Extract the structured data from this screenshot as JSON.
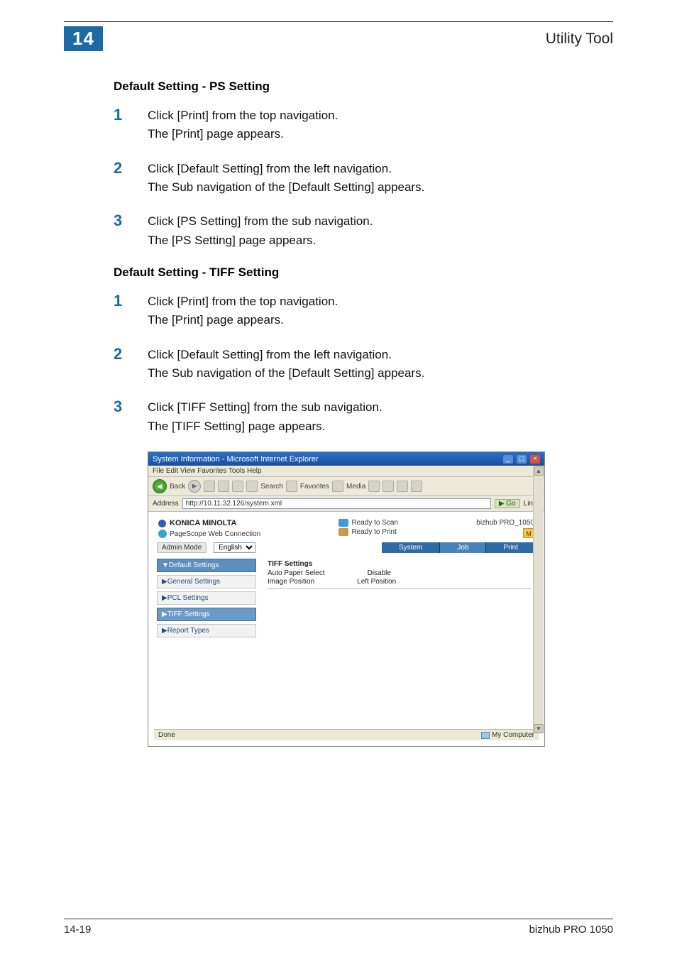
{
  "header": {
    "chapter_number": "14",
    "chapter_title": "Utility Tool"
  },
  "sections": [
    {
      "heading": "Default Setting - PS Setting",
      "steps": [
        {
          "num": "1",
          "line1": "Click [Print] from the top navigation.",
          "line2": "The [Print] page appears."
        },
        {
          "num": "2",
          "line1": "Click [Default Setting] from the left navigation.",
          "line2": "The Sub navigation of the [Default Setting] appears."
        },
        {
          "num": "3",
          "line1": "Click [PS Setting] from the sub navigation.",
          "line2": "The [PS Setting] page appears."
        }
      ]
    },
    {
      "heading": "Default Setting - TIFF Setting",
      "steps": [
        {
          "num": "1",
          "line1": "Click [Print] from the top navigation.",
          "line2": "The [Print] page appears."
        },
        {
          "num": "2",
          "line1": "Click [Default Setting] from the left navigation.",
          "line2": "The Sub navigation of the [Default Setting] appears."
        },
        {
          "num": "3",
          "line1": "Click [TIFF Setting] from the sub navigation.",
          "line2": "The [TIFF Setting] page appears."
        }
      ]
    }
  ],
  "screenshot": {
    "window_title": "System Information - Microsoft Internet Explorer",
    "menu": "File   Edit   View   Favorites   Tools   Help",
    "toolbar": {
      "back": "Back",
      "search": "Search",
      "favorites": "Favorites",
      "media": "Media"
    },
    "address_label": "Address",
    "address_value": "http://10.11.32.126/system.xml",
    "go_label": "Go",
    "links_label": "Links",
    "brand": "KONICA MINOLTA",
    "subbrand": "PageScope Web Connection",
    "status_scan": "Ready to Scan",
    "status_print": "Ready to Print",
    "model": "bizhub PRO_1050",
    "model_badge": "M",
    "mode_label": "Admin Mode",
    "lang_value": "English",
    "tabs": {
      "system": "System",
      "job": "Job",
      "print": "Print"
    },
    "nav": {
      "default_settings": "▼Default Settings",
      "general": "▶General Settings",
      "pcl": "▶PCL Settings",
      "tiff": "▶TIFF Settings",
      "report": "▶Report Types"
    },
    "detail": {
      "title": "TIFF Settings",
      "k1": "Auto Paper Select",
      "v1": "Disable",
      "k2": "Image Position",
      "v2": "Left Position"
    },
    "statusbar_left": "Done",
    "statusbar_right": "My Computer"
  },
  "footer": {
    "page": "14-19",
    "product": "bizhub PRO 1050"
  }
}
